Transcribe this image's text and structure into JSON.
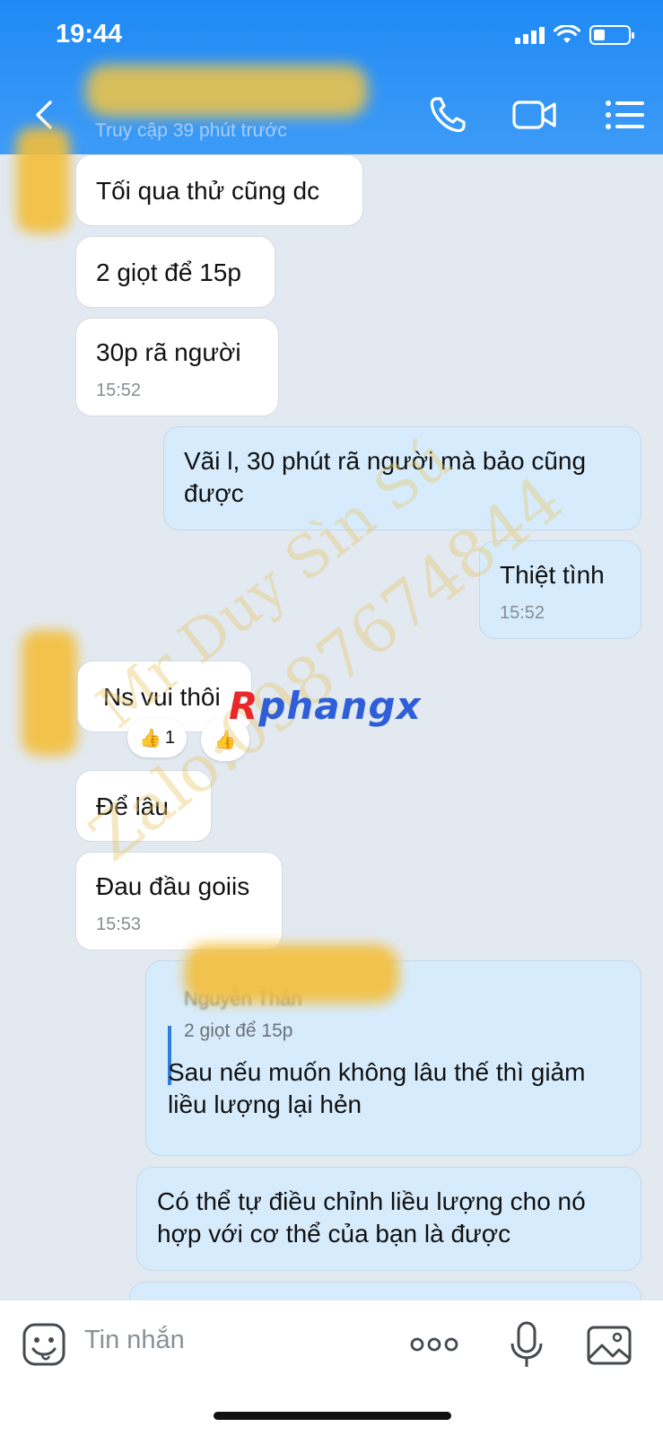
{
  "status_bar": {
    "time": "19:44"
  },
  "header": {
    "contact_status": "Truy cập 39 phút trước",
    "icons": [
      "back-arrow-icon",
      "phone-icon",
      "video-call-icon",
      "menu-list-icon"
    ]
  },
  "messages": [
    {
      "side": "in",
      "text": "Tối qua  thử cũng dc",
      "time": ""
    },
    {
      "side": "in",
      "text": "2 giọt để 15p",
      "time": ""
    },
    {
      "side": "in",
      "text": "30p rã  người",
      "time": "15:52"
    },
    {
      "side": "out",
      "text": "Vãi l, 30 phút rã người mà bảo cũng được",
      "time": ""
    },
    {
      "side": "out",
      "text": "Thiệt tình",
      "time": "15:52"
    },
    {
      "side": "in",
      "text": "Ns vui thôi",
      "time": "",
      "reaction_count": "1"
    },
    {
      "side": "in",
      "text": "Để lâu",
      "time": ""
    },
    {
      "side": "in",
      "text": "Đau đầu goiis",
      "time": "15:53"
    },
    {
      "side": "out",
      "reply_quote": "2 giọt để 15p",
      "text": "Sau nếu muốn không lâu thế thì giảm liều lượng lại hẻn",
      "time": ""
    },
    {
      "side": "out",
      "text": "Có thể tự điều chỉnh liều lượng cho nó hợp với cơ thể của bạn là được",
      "time": ""
    }
  ],
  "watermark": {
    "line1": "Mr Duy Sìn Sú",
    "line2": "Zalo:0987674844",
    "brand_part1": "R",
    "brand_part2": "phangx"
  },
  "input_bar": {
    "placeholder": "Tin nhắn",
    "icons": [
      "sticker-icon",
      "more-options-icon",
      "microphone-icon",
      "image-gallery-icon"
    ]
  },
  "colors": {
    "header_blue": "#2a90f6",
    "outgoing_bubble": "#d6ecfd",
    "incoming_bubble": "#ffffff",
    "chat_background": "#e2e9f1"
  }
}
